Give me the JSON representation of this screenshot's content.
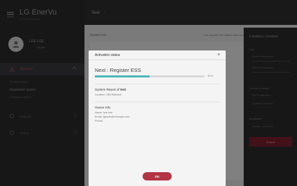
{
  "brand": {
    "title": "LG EnerVu",
    "subtitle": "for Professionals"
  },
  "profile": {
    "name": "LGE LGE",
    "role": "Installer"
  },
  "sidebar": {
    "active_item": "System",
    "sub_items": [
      "Overall Insight",
      "Registration System",
      "Firmware Update"
    ],
    "items": [
      "Analysis",
      "Setting"
    ]
  },
  "topbar": {
    "crumb": "Test",
    "sep_icon": "chevron-right"
  },
  "content": {
    "heading": "System info",
    "note": "It is required for battery data & ems"
  },
  "right_panel": {
    "title": "Installation Checklist",
    "lines": [
      "Unit",
      "System information",
      "Battery information",
      "Service Contract",
      "Site Registration",
      "Installation",
      "Installer Confirmed"
    ],
    "button": "Submit"
  },
  "modal": {
    "title": "Activation status",
    "progress_label": "Next : Register ESS",
    "progress_value": 50,
    "progress_text": "50%",
    "section1": {
      "title_prefix": "System Report of ",
      "title_name": "test",
      "line": "Location: 363 Wilwood"
    },
    "section2": {
      "title": "Owner Info",
      "lines": [
        "Name: test test",
        "Email: lgesole@example.com",
        "Phone:"
      ]
    },
    "ok_label": "OK"
  }
}
